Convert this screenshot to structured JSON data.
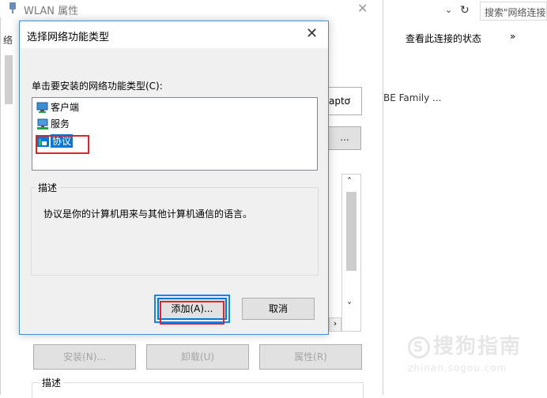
{
  "background_window": {
    "title": "WLAN 属性",
    "side_text_top": "络",
    "adapter_fragment": "aptơ",
    "ellipsis_button": "...",
    "buttons": {
      "install": "安装(N)...",
      "uninstall": "卸载(U)",
      "properties": "属性(R)"
    },
    "description_legend": "描述"
  },
  "explorer": {
    "search_placeholder": "搜索\"网络连接\"",
    "view_status": "查看此连接的状态",
    "more": "»",
    "item_text": "BE Family ..."
  },
  "dialog": {
    "title": "选择网络功能类型",
    "prompt": "单击要安装的网络功能类型(C):",
    "items": [
      {
        "label": "客户端",
        "icon": "client-icon",
        "selected": false
      },
      {
        "label": "服务",
        "icon": "service-icon",
        "selected": false
      },
      {
        "label": "协议",
        "icon": "protocol-icon",
        "selected": true
      }
    ],
    "description_legend": "描述",
    "description_text": "协议是你的计算机用来与其他计算机通信的语言。",
    "add_button": "添加(A)...",
    "cancel_button": "取消"
  },
  "watermark": {
    "brand": "搜狗指南",
    "domain": "zhinan.sogou.com"
  },
  "colors": {
    "accent": "#0078d7",
    "highlight_red": "#e0232b",
    "highlight_blue": "#0a84ff"
  }
}
